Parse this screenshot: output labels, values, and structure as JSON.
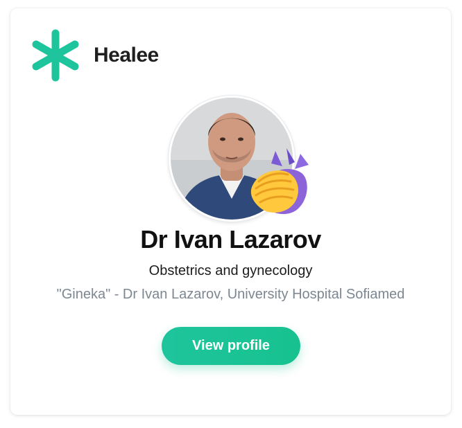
{
  "brand": {
    "name": "Healee",
    "logo_icon": "asterisk-logo-icon",
    "accent_color": "#1ec49c"
  },
  "doctor": {
    "avatar_icon": "doctor-photo",
    "badge_icon": "clapping-hands-icon",
    "name": "Dr Ivan Lazarov",
    "specialty": "Obstetrics and gynecology",
    "clinic": "\"Gineka\" - Dr Ivan Lazarov, University Hospital Sofiamed"
  },
  "actions": {
    "view_profile_label": "View profile"
  }
}
